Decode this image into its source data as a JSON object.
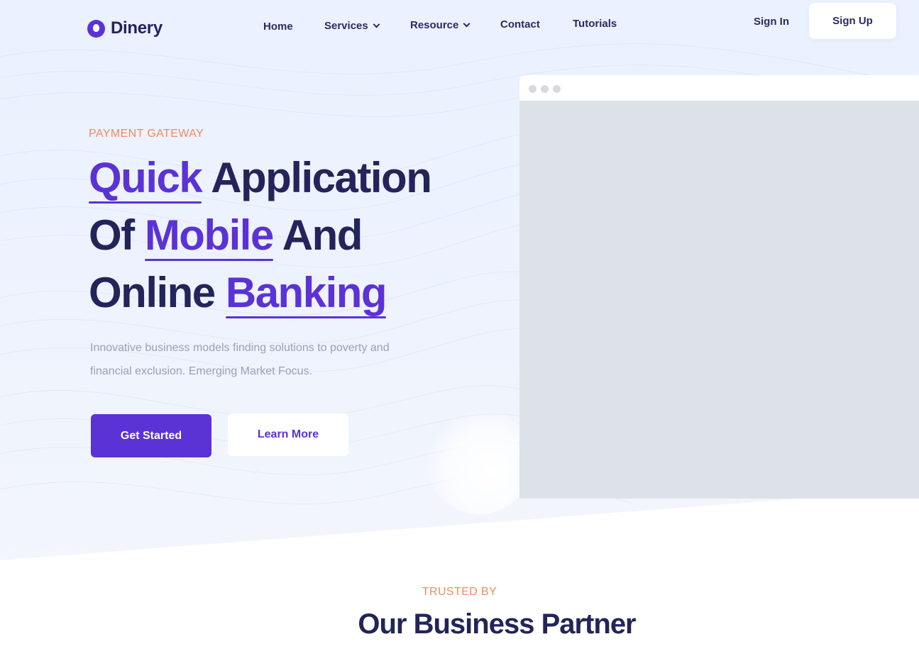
{
  "brand": {
    "name": "Dinery",
    "accent": "#5b32d6",
    "dark": "#22245a",
    "orange": "#f08a5d"
  },
  "nav": {
    "items": [
      {
        "label": "Home",
        "has_dropdown": false
      },
      {
        "label": "Services",
        "has_dropdown": true
      },
      {
        "label": "Resource",
        "has_dropdown": true
      },
      {
        "label": "Contact",
        "has_dropdown": false
      },
      {
        "label": "Tutorials",
        "has_dropdown": false
      }
    ],
    "sign_in": "Sign In",
    "sign_up": "Sign Up"
  },
  "hero": {
    "eyebrow": "PAYMENT GATEWAY",
    "headline": {
      "line1": {
        "highlight": "Quick",
        "rest": "Application"
      },
      "line2": {
        "pre": "Of",
        "highlight": "Mobile",
        "post": "And"
      },
      "line3": {
        "pre": "Online",
        "highlight": "Banking"
      }
    },
    "description": "Innovative business models finding solutions to poverty and financial exclusion. Emerging Market Focus.",
    "primary_button": "Get Started",
    "secondary_button": "Learn More"
  },
  "partners": {
    "eyebrow": "TRUSTED BY",
    "title": "Our Business Partner"
  }
}
